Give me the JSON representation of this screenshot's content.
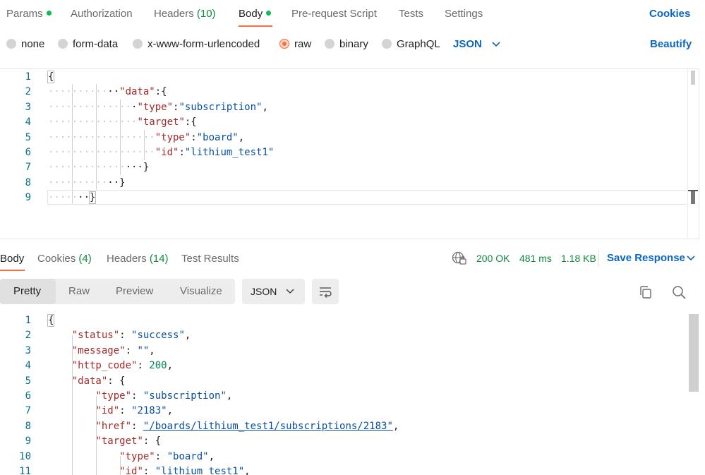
{
  "request_tabs": {
    "params": "Params",
    "authorization": "Authorization",
    "headers": "Headers",
    "headers_count": "(10)",
    "body": "Body",
    "pre_request": "Pre-request Script",
    "tests": "Tests",
    "settings": "Settings",
    "cookies": "Cookies"
  },
  "body_types": {
    "none": "none",
    "form_data": "form-data",
    "urlencoded": "x-www-form-urlencoded",
    "raw": "raw",
    "binary": "binary",
    "graphql": "GraphQL",
    "selected": "raw",
    "language": "JSON",
    "beautify": "Beautify"
  },
  "request_body": {
    "line_numbers": [
      "1",
      "2",
      "3",
      "4",
      "5",
      "6",
      "7",
      "8",
      "9"
    ],
    "l1_brace": "{",
    "l2_key": "\"data\"",
    "l2_rest": ":{",
    "l3_key": "\"type\"",
    "l3_colon": ":",
    "l3_val": "\"subscription\"",
    "l3_comma": ",",
    "l4_key": "\"target\"",
    "l4_rest": ":{",
    "l5_key": "\"type\"",
    "l5_colon": ":",
    "l5_val": "\"board\"",
    "l5_comma": ",",
    "l6_key": "\"id\"",
    "l6_colon": ":",
    "l6_val": "\"lithium_test1\"",
    "l7_brace": "}",
    "l8_brace": "}",
    "l9_brace": "}"
  },
  "response_tabs": {
    "body": "Body",
    "cookies": "Cookies",
    "cookies_count": "(4)",
    "headers": "Headers",
    "headers_count": "(14)",
    "test_results": "Test Results"
  },
  "response_status": {
    "status": "200 OK",
    "time": "481 ms",
    "size": "1.18 KB",
    "save": "Save Response"
  },
  "view_modes": {
    "pretty": "Pretty",
    "raw": "Raw",
    "preview": "Preview",
    "visualize": "Visualize",
    "format": "JSON"
  },
  "response_body": {
    "line_numbers": [
      "1",
      "2",
      "3",
      "4",
      "5",
      "6",
      "7",
      "8",
      "9",
      "10",
      "11"
    ],
    "l1": "{",
    "l2_key": "\"status\"",
    "l2_val": "\"success\"",
    "l3_key": "\"message\"",
    "l3_val": "\"\"",
    "l4_key": "\"http_code\"",
    "l4_val": "200",
    "l5_key": "\"data\"",
    "l5_rest": "{",
    "l6_key": "\"type\"",
    "l6_val": "\"subscription\"",
    "l7_key": "\"id\"",
    "l7_val": "\"2183\"",
    "l8_key": "\"href\"",
    "l8_val": "\"/boards/lithium_test1/subscriptions/2183\"",
    "l9_key": "\"target\"",
    "l9_rest": "{",
    "l10_key": "\"type\"",
    "l10_val": "\"board\"",
    "l11_key": "\"id\"",
    "l11_val": "\"lithium_test1\""
  },
  "colors": {
    "accent": "#ff6c37",
    "link": "#0b66c3",
    "success": "#0f8a3d",
    "json_key": "#a52a2a",
    "json_string": "#0b4fa0"
  }
}
